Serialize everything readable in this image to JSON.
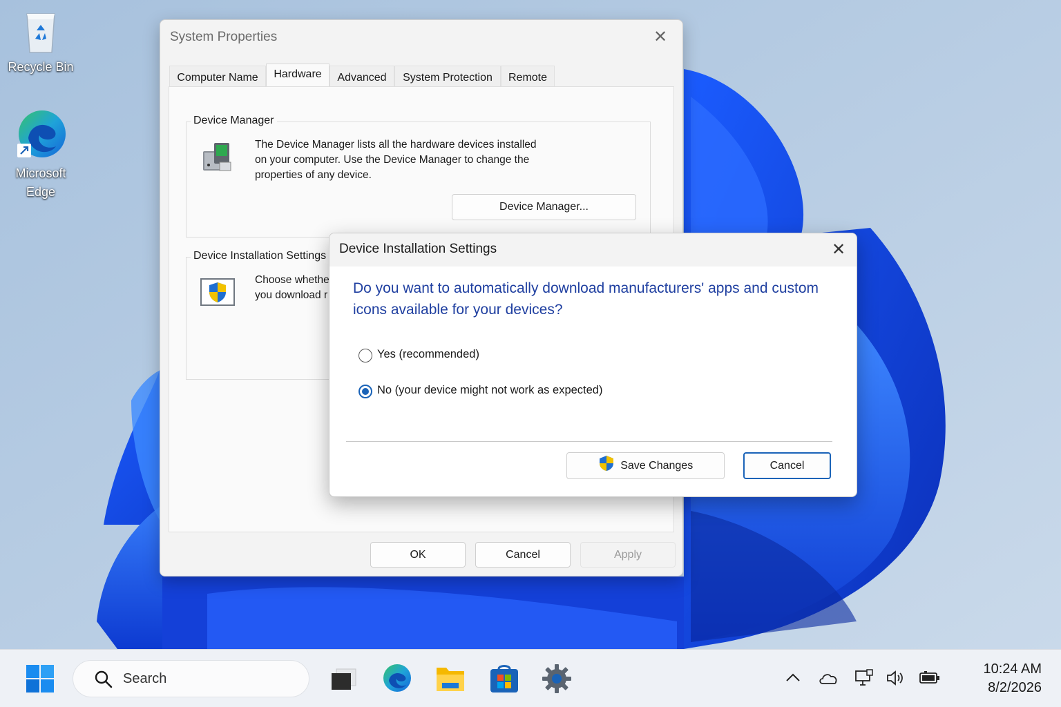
{
  "desktop": {
    "icons": [
      {
        "label": "Recycle Bin",
        "icon": "recycle-bin-icon"
      },
      {
        "label": "Microsoft Edge",
        "icon": "edge-icon"
      }
    ]
  },
  "system_properties": {
    "title": "System Properties",
    "tabs": [
      {
        "label": "Computer Name",
        "active": false
      },
      {
        "label": "Hardware",
        "active": true
      },
      {
        "label": "Advanced",
        "active": false
      },
      {
        "label": "System Protection",
        "active": false
      },
      {
        "label": "Remote",
        "active": false
      }
    ],
    "device_manager": {
      "legend": "Device Manager",
      "text": "The Device Manager lists all the hardware devices installed on your computer. Use the Device Manager to change the properties of any device.",
      "lines": [
        "The Device Manager lists all the hardware devices installed",
        "on your computer. Use the Device Manager to change the",
        "properties of any device."
      ],
      "button": "Device Manager..."
    },
    "device_installation": {
      "legend": "Device Installation Settings",
      "lines": [
        "Choose whethe",
        "you download r"
      ]
    },
    "buttons": {
      "ok": "OK",
      "cancel": "Cancel",
      "apply": "Apply"
    }
  },
  "device_installation_dialog": {
    "title": "Device Installation Settings",
    "question_lines": [
      "Do you want to automatically download manufacturers' apps and custom",
      "icons available for your devices?"
    ],
    "options": [
      {
        "label": "Yes (recommended)",
        "checked": false
      },
      {
        "label": "No (your device might not work as expected)",
        "checked": true
      }
    ],
    "save_button": "Save Changes",
    "cancel_button": "Cancel",
    "accent_color": "#1f3fa0"
  },
  "taskbar": {
    "search_label": "Search",
    "apps": [
      "start-icon",
      "task-view-icon",
      "edge-icon",
      "file-explorer-icon",
      "store-icon",
      "settings-icon"
    ],
    "tray": [
      "chevron-up-icon",
      "onedrive-icon",
      "network-icon",
      "volume-icon",
      "battery-icon"
    ],
    "time": "10:24 AM",
    "date": "8/2/2026"
  }
}
